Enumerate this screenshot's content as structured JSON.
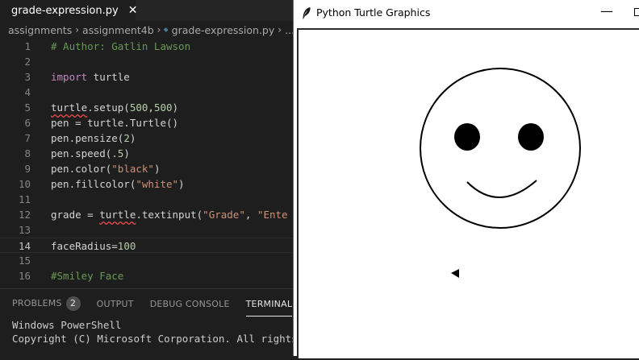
{
  "editor_tab": {
    "filename": "grade-expression.py",
    "close_glyph": "✕",
    "icon": "python-file-icon"
  },
  "breadcrumb": {
    "parts": [
      "assignments",
      "assignment4b",
      "grade-expression.py",
      "..."
    ],
    "separator": "›"
  },
  "code_lines": [
    {
      "num": "1",
      "tokens": [
        {
          "text": "# Author: Gatlin Lawson",
          "cls": "t-comment"
        }
      ]
    },
    {
      "num": "2",
      "tokens": []
    },
    {
      "num": "3",
      "tokens": [
        {
          "text": "import",
          "cls": "t-keyword"
        },
        {
          "text": " turtle",
          "cls": ""
        }
      ]
    },
    {
      "num": "4",
      "tokens": []
    },
    {
      "num": "5",
      "tokens": [
        {
          "text": "turtle",
          "cls": "t-squiggle"
        },
        {
          "text": ".setup(",
          "cls": ""
        },
        {
          "text": "500",
          "cls": "t-number"
        },
        {
          "text": ",",
          "cls": ""
        },
        {
          "text": "500",
          "cls": "t-number"
        },
        {
          "text": ")",
          "cls": ""
        }
      ]
    },
    {
      "num": "6",
      "tokens": [
        {
          "text": "pen = turtle.Turtle()",
          "cls": ""
        }
      ]
    },
    {
      "num": "7",
      "tokens": [
        {
          "text": "pen.pensize(",
          "cls": ""
        },
        {
          "text": "2",
          "cls": "t-number"
        },
        {
          "text": ")",
          "cls": ""
        }
      ]
    },
    {
      "num": "8",
      "tokens": [
        {
          "text": "pen.speed(",
          "cls": ""
        },
        {
          "text": ".5",
          "cls": "t-number"
        },
        {
          "text": ")",
          "cls": ""
        }
      ]
    },
    {
      "num": "9",
      "tokens": [
        {
          "text": "pen.color(",
          "cls": ""
        },
        {
          "text": "\"black\"",
          "cls": "t-string"
        },
        {
          "text": ")",
          "cls": ""
        }
      ]
    },
    {
      "num": "10",
      "tokens": [
        {
          "text": "pen.fillcolor(",
          "cls": ""
        },
        {
          "text": "\"white\"",
          "cls": "t-string"
        },
        {
          "text": ")",
          "cls": ""
        }
      ]
    },
    {
      "num": "11",
      "tokens": []
    },
    {
      "num": "12",
      "tokens": [
        {
          "text": "grade = ",
          "cls": ""
        },
        {
          "text": "turtle",
          "cls": "t-squiggle"
        },
        {
          "text": ".textinput(",
          "cls": ""
        },
        {
          "text": "\"Grade\"",
          "cls": "t-string"
        },
        {
          "text": ", ",
          "cls": ""
        },
        {
          "text": "\"Ente",
          "cls": "t-string"
        }
      ]
    },
    {
      "num": "13",
      "tokens": []
    },
    {
      "num": "14",
      "current": true,
      "tokens": [
        {
          "text": "faceRadius=",
          "cls": ""
        },
        {
          "text": "100",
          "cls": "t-number"
        }
      ]
    },
    {
      "num": "15",
      "tokens": []
    },
    {
      "num": "16",
      "tokens": [
        {
          "text": "#Smiley Face",
          "cls": "t-comment"
        }
      ]
    }
  ],
  "panel": {
    "tabs": [
      {
        "label": "PROBLEMS",
        "badge": "2",
        "active": false
      },
      {
        "label": "OUTPUT",
        "active": false
      },
      {
        "label": "DEBUG CONSOLE",
        "active": false
      },
      {
        "label": "TERMINAL",
        "active": true
      }
    ],
    "terminal_lines": [
      "Windows PowerShell",
      "Copyright (C) Microsoft Corporation. All rights re"
    ]
  },
  "turtle_window": {
    "title": "Python Turtle Graphics",
    "minimize_glyph": "—",
    "app_icon": "feather-icon"
  },
  "colors": {
    "editor_bg": "#1e1e1e",
    "comment": "#6a9955",
    "keyword": "#c586c0",
    "number": "#b5cea8",
    "string": "#ce9178",
    "squiggle": "#f14c4c",
    "canvas_bg": "#ffffff",
    "ink": "#000000"
  }
}
